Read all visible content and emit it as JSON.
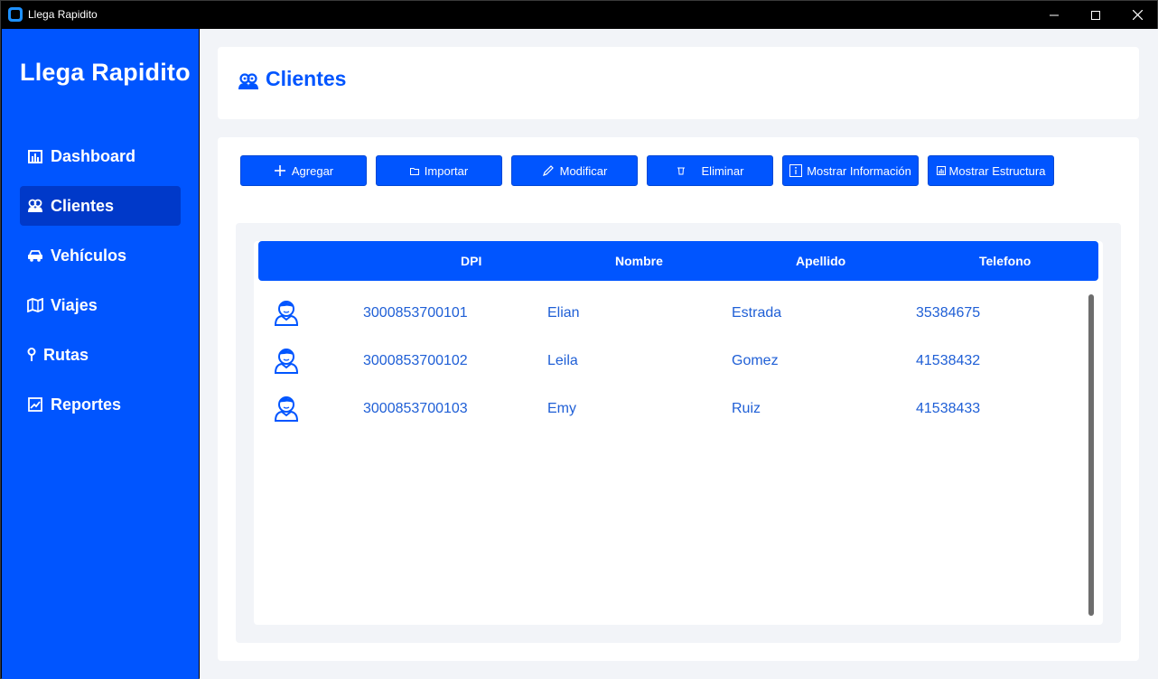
{
  "window": {
    "title": "Llega Rapidito",
    "controls": {
      "minimize": "—",
      "maximize": "☐",
      "close": "✕"
    }
  },
  "sidebar": {
    "brand": "Llega Rapidito",
    "items": [
      {
        "label": "Dashboard",
        "icon": "bar-chart-icon",
        "active": false
      },
      {
        "label": "Clientes",
        "icon": "users-icon",
        "active": true
      },
      {
        "label": "Vehículos",
        "icon": "car-icon",
        "active": false
      },
      {
        "label": "Viajes",
        "icon": "map-icon",
        "active": false
      },
      {
        "label": "Rutas",
        "icon": "pin-icon",
        "active": false
      },
      {
        "label": "Reportes",
        "icon": "report-icon",
        "active": false
      }
    ]
  },
  "header": {
    "title": "Clientes",
    "icon": "users-icon"
  },
  "toolbar": {
    "buttons": [
      {
        "label": "Agregar",
        "icon": "plus-icon"
      },
      {
        "label": "Importar",
        "icon": "folder-icon"
      },
      {
        "label": "Modificar",
        "icon": "pencil-icon"
      },
      {
        "label": "Eliminar",
        "icon": "trash-icon"
      },
      {
        "label": "Mostrar Información",
        "icon": "info-icon"
      },
      {
        "label": "Mostrar Estructura",
        "icon": "structure-icon"
      }
    ]
  },
  "table": {
    "columns": [
      "DPI",
      "Nombre",
      "Apellido",
      "Telefono"
    ],
    "rows": [
      {
        "dpi": "3000853700101",
        "nombre": "Elian",
        "apellido": "Estrada",
        "telefono": "35384675"
      },
      {
        "dpi": "3000853700102",
        "nombre": "Leila",
        "apellido": "Gomez",
        "telefono": "41538432"
      },
      {
        "dpi": "3000853700103",
        "nombre": "Emy",
        "apellido": "Ruiz",
        "telefono": "41538433"
      }
    ]
  },
  "colors": {
    "accent": "#0055ff",
    "active_nav": "#0039c9",
    "text_blue": "#1f5fd6",
    "background": "#f2f4f8"
  }
}
